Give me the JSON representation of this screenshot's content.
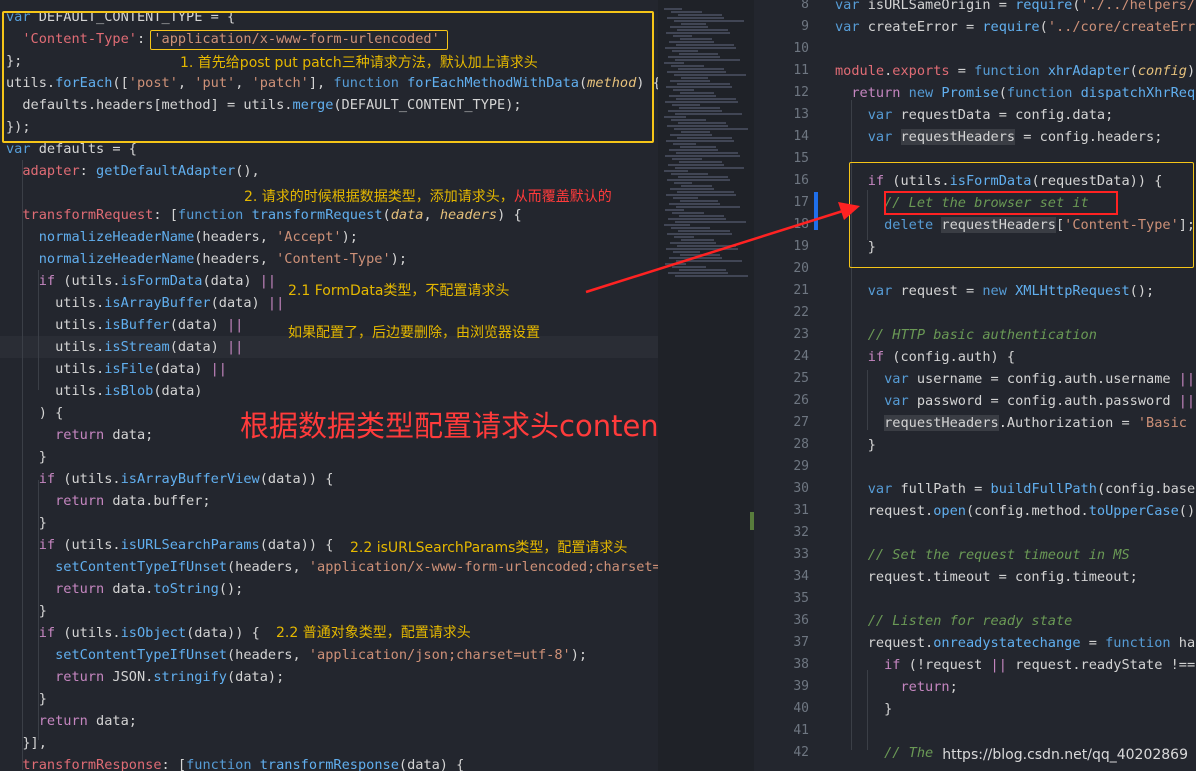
{
  "left": {
    "lines": [
      [
        [
          "kw",
          "var"
        ],
        [
          "var",
          " DEFAULT_CONTENT_TYPE = {"
        ]
      ],
      [
        [
          "var",
          "  "
        ],
        [
          "key",
          "'Content-Type'"
        ],
        [
          "var",
          ": "
        ],
        [
          "str",
          "'application/x-www-form-urlencoded'"
        ]
      ],
      [
        [
          "var",
          "};"
        ]
      ],
      [
        [
          "var",
          "utils."
        ],
        [
          "fn",
          "forEach"
        ],
        [
          "var",
          "(["
        ],
        [
          "str",
          "'post'"
        ],
        [
          "var",
          ", "
        ],
        [
          "str",
          "'put'"
        ],
        [
          "var",
          ", "
        ],
        [
          "str",
          "'patch'"
        ],
        [
          "var",
          "], "
        ],
        [
          "kw",
          "function"
        ],
        [
          "var",
          " "
        ],
        [
          "fn",
          "forEachMethodWithData"
        ],
        [
          "var",
          "("
        ],
        [
          "prm",
          "method"
        ],
        [
          "var",
          ") {"
        ]
      ],
      [
        [
          "var",
          "  defaults.headers[method] = utils."
        ],
        [
          "fn",
          "merge"
        ],
        [
          "var",
          "(DEFAULT_CONTENT_TYPE);"
        ]
      ],
      [
        [
          "var",
          "});"
        ]
      ],
      [
        [
          "kw",
          "var"
        ],
        [
          "var",
          " defaults = {"
        ]
      ],
      [
        [
          "var",
          "  "
        ],
        [
          "key",
          "adapter"
        ],
        [
          "var",
          ": "
        ],
        [
          "fn",
          "getDefaultAdapter"
        ],
        [
          "var",
          "(),"
        ]
      ],
      [
        [
          "var",
          ""
        ]
      ],
      [
        [
          "var",
          "  "
        ],
        [
          "key",
          "transformRequest"
        ],
        [
          "var",
          ": ["
        ],
        [
          "kw",
          "function"
        ],
        [
          "var",
          " "
        ],
        [
          "fn",
          "transformRequest"
        ],
        [
          "var",
          "("
        ],
        [
          "prm",
          "data"
        ],
        [
          "var",
          ", "
        ],
        [
          "prm",
          "headers"
        ],
        [
          "var",
          ") {"
        ]
      ],
      [
        [
          "var",
          "    "
        ],
        [
          "fn",
          "normalizeHeaderName"
        ],
        [
          "var",
          "(headers, "
        ],
        [
          "str",
          "'Accept'"
        ],
        [
          "var",
          ");"
        ]
      ],
      [
        [
          "var",
          "    "
        ],
        [
          "fn",
          "normalizeHeaderName"
        ],
        [
          "var",
          "(headers, "
        ],
        [
          "str",
          "'Content-Type'"
        ],
        [
          "var",
          ");"
        ]
      ],
      [
        [
          "var",
          "    "
        ],
        [
          "op",
          "if"
        ],
        [
          "var",
          " (utils."
        ],
        [
          "fn",
          "isFormData"
        ],
        [
          "var",
          "(data) "
        ],
        [
          "op",
          "||"
        ]
      ],
      [
        [
          "var",
          "      utils."
        ],
        [
          "fn",
          "isArrayBuffer"
        ],
        [
          "var",
          "(data) "
        ],
        [
          "op",
          "||"
        ]
      ],
      [
        [
          "var",
          "      utils."
        ],
        [
          "fn",
          "isBuffer"
        ],
        [
          "var",
          "(data) "
        ],
        [
          "op",
          "||"
        ]
      ],
      [
        [
          "var",
          "      utils."
        ],
        [
          "fn",
          "isStream"
        ],
        [
          "var",
          "(data) "
        ],
        [
          "op",
          "||"
        ]
      ],
      [
        [
          "var",
          "      utils."
        ],
        [
          "fn",
          "isFile"
        ],
        [
          "var",
          "(data) "
        ],
        [
          "op",
          "||"
        ]
      ],
      [
        [
          "var",
          "      utils."
        ],
        [
          "fn",
          "isBlob"
        ],
        [
          "var",
          "(data)"
        ]
      ],
      [
        [
          "var",
          "    ) {"
        ]
      ],
      [
        [
          "var",
          "      "
        ],
        [
          "op",
          "return"
        ],
        [
          "var",
          " data;"
        ]
      ],
      [
        [
          "var",
          "    }"
        ]
      ],
      [
        [
          "var",
          "    "
        ],
        [
          "op",
          "if"
        ],
        [
          "var",
          " (utils."
        ],
        [
          "fn",
          "isArrayBufferView"
        ],
        [
          "var",
          "(data)) {"
        ]
      ],
      [
        [
          "var",
          "      "
        ],
        [
          "op",
          "return"
        ],
        [
          "var",
          " data.buffer;"
        ]
      ],
      [
        [
          "var",
          "    }"
        ]
      ],
      [
        [
          "var",
          "    "
        ],
        [
          "op",
          "if"
        ],
        [
          "var",
          " (utils."
        ],
        [
          "fn",
          "isURLSearchParams"
        ],
        [
          "var",
          "(data)) {"
        ]
      ],
      [
        [
          "var",
          "      "
        ],
        [
          "fn",
          "setContentTypeIfUnset"
        ],
        [
          "var",
          "(headers, "
        ],
        [
          "str",
          "'application/x-www-form-urlencoded;charset="
        ]
      ],
      [
        [
          "var",
          "      "
        ],
        [
          "op",
          "return"
        ],
        [
          "var",
          " data."
        ],
        [
          "fn",
          "toString"
        ],
        [
          "var",
          "();"
        ]
      ],
      [
        [
          "var",
          "    }"
        ]
      ],
      [
        [
          "var",
          "    "
        ],
        [
          "op",
          "if"
        ],
        [
          "var",
          " (utils."
        ],
        [
          "fn",
          "isObject"
        ],
        [
          "var",
          "(data)) {"
        ]
      ],
      [
        [
          "var",
          "      "
        ],
        [
          "fn",
          "setContentTypeIfUnset"
        ],
        [
          "var",
          "(headers, "
        ],
        [
          "str",
          "'application/json;charset=utf-8'"
        ],
        [
          "var",
          ");"
        ]
      ],
      [
        [
          "var",
          "      "
        ],
        [
          "op",
          "return"
        ],
        [
          "var",
          " JSON."
        ],
        [
          "fn",
          "stringify"
        ],
        [
          "var",
          "(data);"
        ]
      ],
      [
        [
          "var",
          "    }"
        ]
      ],
      [
        [
          "var",
          "    "
        ],
        [
          "op",
          "return"
        ],
        [
          "var",
          " data;"
        ]
      ],
      [
        [
          "var",
          "  }],"
        ]
      ],
      [
        [
          "var",
          "  "
        ],
        [
          "key",
          "transformResponse"
        ],
        [
          "var",
          ": ["
        ],
        [
          "kw",
          "function"
        ],
        [
          "var",
          " "
        ],
        [
          "fn",
          "transformResponse"
        ],
        [
          "var",
          "(data) {"
        ]
      ]
    ]
  },
  "right": {
    "line_numbers": [
      "8",
      "9",
      "10",
      "11",
      "12",
      "13",
      "14",
      "15",
      "16",
      "17",
      "18",
      "19",
      "20",
      "21",
      "22",
      "23",
      "24",
      "25",
      "26",
      "27",
      "28",
      "29",
      "30",
      "31",
      "32",
      "33",
      "34",
      "35",
      "36",
      "37",
      "38",
      "39",
      "40",
      "41",
      "42"
    ],
    "lines": [
      [
        [
          "kw",
          "var"
        ],
        [
          "var",
          " isURLSameOrigin = "
        ],
        [
          "fn",
          "require"
        ],
        [
          "var",
          "("
        ],
        [
          "str",
          "'./../helpers/"
        ]
      ],
      [
        [
          "kw",
          "var"
        ],
        [
          "var",
          " createError = "
        ],
        [
          "fn",
          "require"
        ],
        [
          "var",
          "("
        ],
        [
          "str",
          "'../core/createErr"
        ]
      ],
      [
        [
          "var",
          ""
        ]
      ],
      [
        [
          "key",
          "module"
        ],
        [
          "var",
          "."
        ],
        [
          "key",
          "exports"
        ],
        [
          "var",
          " = "
        ],
        [
          "kw",
          "function"
        ],
        [
          "var",
          " "
        ],
        [
          "fn",
          "xhrAdapter"
        ],
        [
          "var",
          "("
        ],
        [
          "prm",
          "config"
        ],
        [
          "var",
          ")"
        ]
      ],
      [
        [
          "var",
          "  "
        ],
        [
          "op",
          "return"
        ],
        [
          "var",
          " "
        ],
        [
          "kw",
          "new"
        ],
        [
          "var",
          " "
        ],
        [
          "fn",
          "Promise"
        ],
        [
          "var",
          "("
        ],
        [
          "kw",
          "function"
        ],
        [
          "var",
          " "
        ],
        [
          "fn",
          "dispatchXhrReq"
        ]
      ],
      [
        [
          "var",
          "    "
        ],
        [
          "kw",
          "var"
        ],
        [
          "var",
          " requestData = config.data;"
        ]
      ],
      [
        [
          "var",
          "    "
        ],
        [
          "kw",
          "var"
        ],
        [
          "var",
          " "
        ],
        [
          "hl",
          "requestHeaders"
        ],
        [
          "var",
          " = config.headers;"
        ]
      ],
      [
        [
          "var",
          ""
        ]
      ],
      [
        [
          "var",
          "    "
        ],
        [
          "op",
          "if"
        ],
        [
          "var",
          " (utils."
        ],
        [
          "fn",
          "isFormData"
        ],
        [
          "var",
          "(requestData)) {"
        ]
      ],
      [
        [
          "var",
          "      "
        ],
        [
          "cmt",
          "// Let the browser set it"
        ]
      ],
      [
        [
          "var",
          "      "
        ],
        [
          "kw",
          "delete"
        ],
        [
          "var",
          " "
        ],
        [
          "hl",
          "requestHeaders"
        ],
        [
          "var",
          "["
        ],
        [
          "str",
          "'Content-Type'"
        ],
        [
          "var",
          "];"
        ]
      ],
      [
        [
          "var",
          "    }"
        ]
      ],
      [
        [
          "var",
          ""
        ]
      ],
      [
        [
          "var",
          "    "
        ],
        [
          "kw",
          "var"
        ],
        [
          "var",
          " request = "
        ],
        [
          "kw",
          "new"
        ],
        [
          "var",
          " "
        ],
        [
          "fn",
          "XMLHttpRequest"
        ],
        [
          "var",
          "();"
        ]
      ],
      [
        [
          "var",
          ""
        ]
      ],
      [
        [
          "var",
          "    "
        ],
        [
          "cmt",
          "// HTTP basic authentication"
        ]
      ],
      [
        [
          "var",
          "    "
        ],
        [
          "op",
          "if"
        ],
        [
          "var",
          " (config.auth) {"
        ]
      ],
      [
        [
          "var",
          "      "
        ],
        [
          "kw",
          "var"
        ],
        [
          "var",
          " username = config.auth.username "
        ],
        [
          "op",
          "||"
        ]
      ],
      [
        [
          "var",
          "      "
        ],
        [
          "kw",
          "var"
        ],
        [
          "var",
          " password = config.auth.password "
        ],
        [
          "op",
          "||"
        ]
      ],
      [
        [
          "var",
          "      "
        ],
        [
          "hl",
          "requestHeaders"
        ],
        [
          "var",
          ".Authorization = "
        ],
        [
          "str",
          "'Basic"
        ]
      ],
      [
        [
          "var",
          "    }"
        ]
      ],
      [
        [
          "var",
          ""
        ]
      ],
      [
        [
          "var",
          "    "
        ],
        [
          "kw",
          "var"
        ],
        [
          "var",
          " fullPath = "
        ],
        [
          "fn",
          "buildFullPath"
        ],
        [
          "var",
          "(config.base"
        ]
      ],
      [
        [
          "var",
          "    request."
        ],
        [
          "fn",
          "open"
        ],
        [
          "var",
          "(config.method."
        ],
        [
          "fn",
          "toUpperCase"
        ],
        [
          "var",
          "()"
        ]
      ],
      [
        [
          "var",
          ""
        ]
      ],
      [
        [
          "var",
          "    "
        ],
        [
          "cmt",
          "// Set the request timeout in MS"
        ]
      ],
      [
        [
          "var",
          "    request.timeout = config.timeout;"
        ]
      ],
      [
        [
          "var",
          ""
        ]
      ],
      [
        [
          "var",
          "    "
        ],
        [
          "cmt",
          "// Listen for ready state"
        ]
      ],
      [
        [
          "var",
          "    request."
        ],
        [
          "fn",
          "onreadystatechange"
        ],
        [
          "var",
          " = "
        ],
        [
          "kw",
          "function"
        ],
        [
          "var",
          " ha"
        ]
      ],
      [
        [
          "var",
          "      "
        ],
        [
          "op",
          "if"
        ],
        [
          "var",
          " (!request "
        ],
        [
          "op",
          "||"
        ],
        [
          "var",
          " request.readyState !=="
        ]
      ],
      [
        [
          "var",
          "        "
        ],
        [
          "op",
          "return"
        ],
        [
          "var",
          ";"
        ]
      ],
      [
        [
          "var",
          "      }"
        ]
      ],
      [
        [
          "var",
          ""
        ]
      ],
      [
        [
          "var",
          "      "
        ],
        [
          "cmt",
          "// The"
        ]
      ]
    ]
  },
  "annotations": {
    "a1": "1. 首先给post put patch三种请求方法，默认加上请求头",
    "a2_yellow": "2. 请求的时候根据数据类型，添加请求头，",
    "a2_red": "从而覆盖默认的",
    "a21": "2.1 FormData类型，不配置请求头",
    "a21b": "如果配置了，后边要删除，由浏览器设置",
    "big": "根据数据类型配置请求头content-type",
    "a22": "2.2  isURLSearchParams类型，配置请求头",
    "a23": "2.2  普通对象类型，配置请求头"
  },
  "watermark": "https://blog.csdn.net/qq_40202869",
  "colors": {
    "accent_yellow": "#f5c518",
    "accent_red": "#ff2222",
    "editor_bg": "#23262e"
  }
}
